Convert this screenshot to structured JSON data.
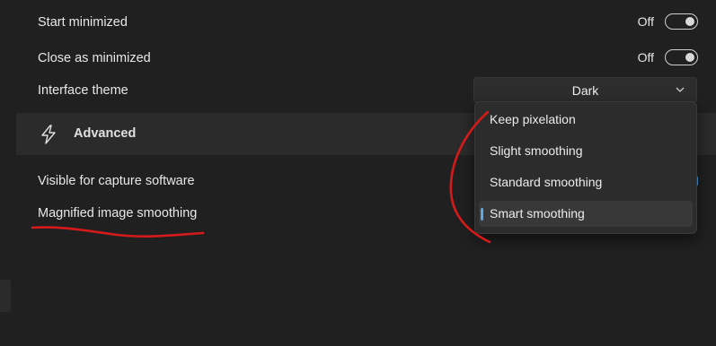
{
  "settings": {
    "start_minimized": {
      "label": "Start minimized",
      "state": "Off"
    },
    "close_minimized": {
      "label": "Close as minimized",
      "state": "Off"
    },
    "interface_theme": {
      "label": "Interface theme",
      "value": "Dark"
    },
    "visible_capture": {
      "label": "Visible for capture software"
    },
    "image_smoothing": {
      "label": "Magnified image smoothing"
    }
  },
  "section": {
    "title": "Advanced",
    "icon": "lightning-bolt-icon"
  },
  "dropdown": {
    "options": [
      {
        "label": "Keep pixelation"
      },
      {
        "label": "Slight smoothing"
      },
      {
        "label": "Standard smoothing"
      },
      {
        "label": "Smart smoothing"
      }
    ],
    "selected": "Smart smoothing"
  },
  "colors": {
    "background": "#202020",
    "section_bg": "#2b2b2b",
    "accent": "#5aa9e6",
    "annotation": "#d41a1a"
  }
}
